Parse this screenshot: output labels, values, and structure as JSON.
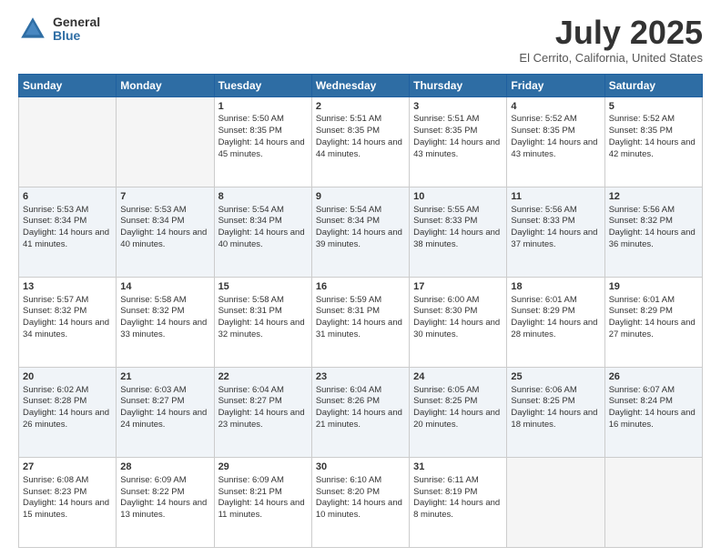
{
  "header": {
    "logo_general": "General",
    "logo_blue": "Blue",
    "title": "July 2025",
    "location": "El Cerrito, California, United States"
  },
  "days_of_week": [
    "Sunday",
    "Monday",
    "Tuesday",
    "Wednesday",
    "Thursday",
    "Friday",
    "Saturday"
  ],
  "weeks": [
    [
      {
        "day": "",
        "empty": true
      },
      {
        "day": "",
        "empty": true
      },
      {
        "day": "1",
        "sunrise": "Sunrise: 5:50 AM",
        "sunset": "Sunset: 8:35 PM",
        "daylight": "Daylight: 14 hours and 45 minutes."
      },
      {
        "day": "2",
        "sunrise": "Sunrise: 5:51 AM",
        "sunset": "Sunset: 8:35 PM",
        "daylight": "Daylight: 14 hours and 44 minutes."
      },
      {
        "day": "3",
        "sunrise": "Sunrise: 5:51 AM",
        "sunset": "Sunset: 8:35 PM",
        "daylight": "Daylight: 14 hours and 43 minutes."
      },
      {
        "day": "4",
        "sunrise": "Sunrise: 5:52 AM",
        "sunset": "Sunset: 8:35 PM",
        "daylight": "Daylight: 14 hours and 43 minutes."
      },
      {
        "day": "5",
        "sunrise": "Sunrise: 5:52 AM",
        "sunset": "Sunset: 8:35 PM",
        "daylight": "Daylight: 14 hours and 42 minutes."
      }
    ],
    [
      {
        "day": "6",
        "sunrise": "Sunrise: 5:53 AM",
        "sunset": "Sunset: 8:34 PM",
        "daylight": "Daylight: 14 hours and 41 minutes."
      },
      {
        "day": "7",
        "sunrise": "Sunrise: 5:53 AM",
        "sunset": "Sunset: 8:34 PM",
        "daylight": "Daylight: 14 hours and 40 minutes."
      },
      {
        "day": "8",
        "sunrise": "Sunrise: 5:54 AM",
        "sunset": "Sunset: 8:34 PM",
        "daylight": "Daylight: 14 hours and 40 minutes."
      },
      {
        "day": "9",
        "sunrise": "Sunrise: 5:54 AM",
        "sunset": "Sunset: 8:34 PM",
        "daylight": "Daylight: 14 hours and 39 minutes."
      },
      {
        "day": "10",
        "sunrise": "Sunrise: 5:55 AM",
        "sunset": "Sunset: 8:33 PM",
        "daylight": "Daylight: 14 hours and 38 minutes."
      },
      {
        "day": "11",
        "sunrise": "Sunrise: 5:56 AM",
        "sunset": "Sunset: 8:33 PM",
        "daylight": "Daylight: 14 hours and 37 minutes."
      },
      {
        "day": "12",
        "sunrise": "Sunrise: 5:56 AM",
        "sunset": "Sunset: 8:32 PM",
        "daylight": "Daylight: 14 hours and 36 minutes."
      }
    ],
    [
      {
        "day": "13",
        "sunrise": "Sunrise: 5:57 AM",
        "sunset": "Sunset: 8:32 PM",
        "daylight": "Daylight: 14 hours and 34 minutes."
      },
      {
        "day": "14",
        "sunrise": "Sunrise: 5:58 AM",
        "sunset": "Sunset: 8:32 PM",
        "daylight": "Daylight: 14 hours and 33 minutes."
      },
      {
        "day": "15",
        "sunrise": "Sunrise: 5:58 AM",
        "sunset": "Sunset: 8:31 PM",
        "daylight": "Daylight: 14 hours and 32 minutes."
      },
      {
        "day": "16",
        "sunrise": "Sunrise: 5:59 AM",
        "sunset": "Sunset: 8:31 PM",
        "daylight": "Daylight: 14 hours and 31 minutes."
      },
      {
        "day": "17",
        "sunrise": "Sunrise: 6:00 AM",
        "sunset": "Sunset: 8:30 PM",
        "daylight": "Daylight: 14 hours and 30 minutes."
      },
      {
        "day": "18",
        "sunrise": "Sunrise: 6:01 AM",
        "sunset": "Sunset: 8:29 PM",
        "daylight": "Daylight: 14 hours and 28 minutes."
      },
      {
        "day": "19",
        "sunrise": "Sunrise: 6:01 AM",
        "sunset": "Sunset: 8:29 PM",
        "daylight": "Daylight: 14 hours and 27 minutes."
      }
    ],
    [
      {
        "day": "20",
        "sunrise": "Sunrise: 6:02 AM",
        "sunset": "Sunset: 8:28 PM",
        "daylight": "Daylight: 14 hours and 26 minutes."
      },
      {
        "day": "21",
        "sunrise": "Sunrise: 6:03 AM",
        "sunset": "Sunset: 8:27 PM",
        "daylight": "Daylight: 14 hours and 24 minutes."
      },
      {
        "day": "22",
        "sunrise": "Sunrise: 6:04 AM",
        "sunset": "Sunset: 8:27 PM",
        "daylight": "Daylight: 14 hours and 23 minutes."
      },
      {
        "day": "23",
        "sunrise": "Sunrise: 6:04 AM",
        "sunset": "Sunset: 8:26 PM",
        "daylight": "Daylight: 14 hours and 21 minutes."
      },
      {
        "day": "24",
        "sunrise": "Sunrise: 6:05 AM",
        "sunset": "Sunset: 8:25 PM",
        "daylight": "Daylight: 14 hours and 20 minutes."
      },
      {
        "day": "25",
        "sunrise": "Sunrise: 6:06 AM",
        "sunset": "Sunset: 8:25 PM",
        "daylight": "Daylight: 14 hours and 18 minutes."
      },
      {
        "day": "26",
        "sunrise": "Sunrise: 6:07 AM",
        "sunset": "Sunset: 8:24 PM",
        "daylight": "Daylight: 14 hours and 16 minutes."
      }
    ],
    [
      {
        "day": "27",
        "sunrise": "Sunrise: 6:08 AM",
        "sunset": "Sunset: 8:23 PM",
        "daylight": "Daylight: 14 hours and 15 minutes."
      },
      {
        "day": "28",
        "sunrise": "Sunrise: 6:09 AM",
        "sunset": "Sunset: 8:22 PM",
        "daylight": "Daylight: 14 hours and 13 minutes."
      },
      {
        "day": "29",
        "sunrise": "Sunrise: 6:09 AM",
        "sunset": "Sunset: 8:21 PM",
        "daylight": "Daylight: 14 hours and 11 minutes."
      },
      {
        "day": "30",
        "sunrise": "Sunrise: 6:10 AM",
        "sunset": "Sunset: 8:20 PM",
        "daylight": "Daylight: 14 hours and 10 minutes."
      },
      {
        "day": "31",
        "sunrise": "Sunrise: 6:11 AM",
        "sunset": "Sunset: 8:19 PM",
        "daylight": "Daylight: 14 hours and 8 minutes."
      },
      {
        "day": "",
        "empty": true
      },
      {
        "day": "",
        "empty": true
      }
    ]
  ]
}
